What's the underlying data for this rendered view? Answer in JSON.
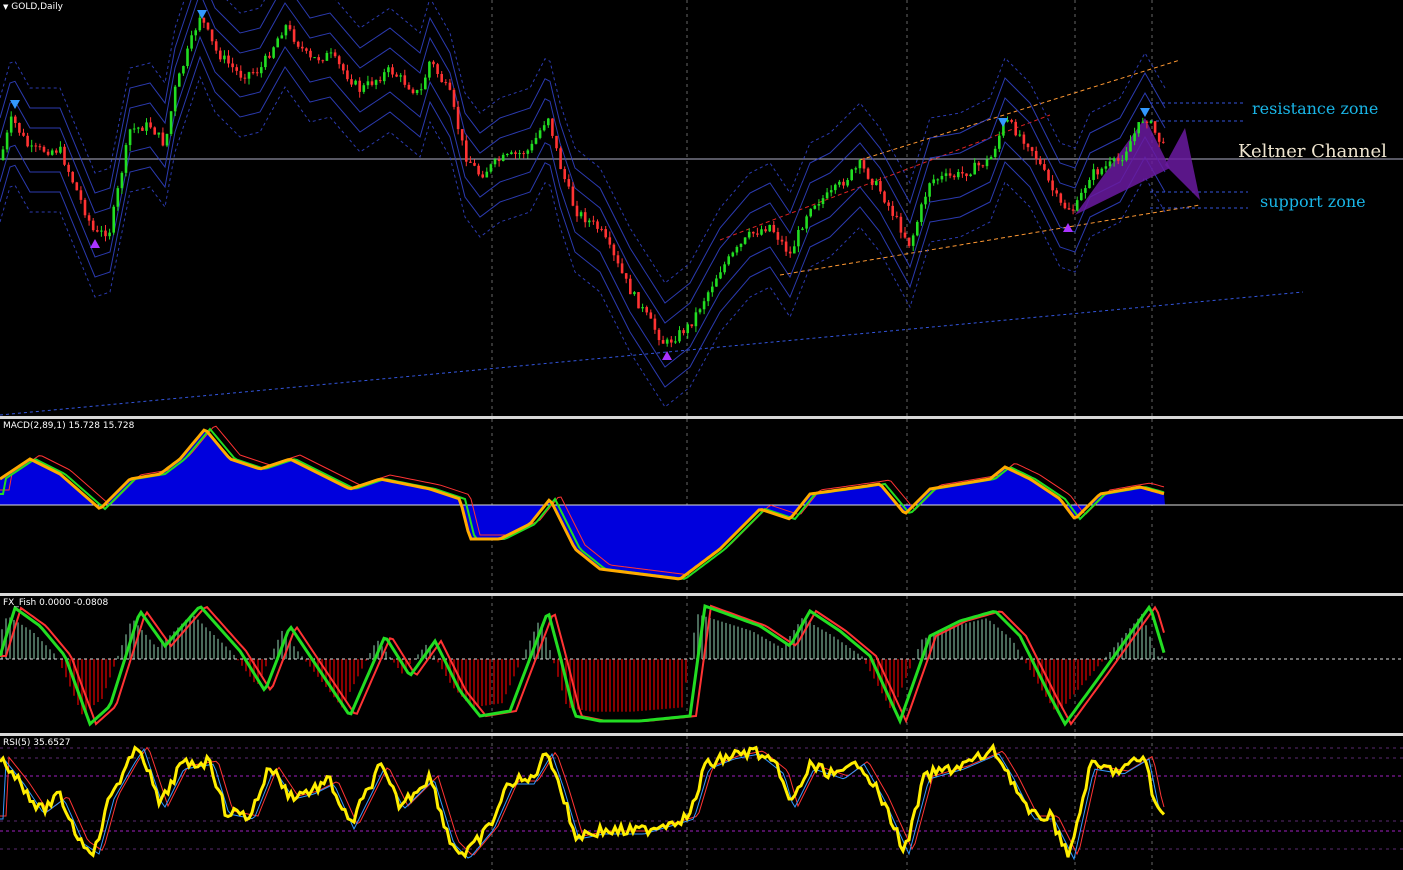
{
  "main_pane": {
    "label": "GOLD,Daily",
    "menu_icon": "triangle-down-icon",
    "annotations": {
      "resistance": "resistance zone",
      "keltner": "Keltner Channel",
      "support": "support zone"
    }
  },
  "macd_pane": {
    "label": "MACD(2,89,1) 15.728 15.728"
  },
  "fish_pane": {
    "label": "FX_Fish 0.0000 -0.0808"
  },
  "rsi_pane": {
    "label": "RSI(5) 35.6527"
  },
  "colors": {
    "bull": "#22dd22",
    "bear": "#ff3333",
    "channel": "#3344cc",
    "macd_fill": "#0000dd",
    "macd_orange": "#ffaa00",
    "macd_green": "#22dd22",
    "fish_pos": "#4a6a5a",
    "fish_neg": "#8a0000",
    "rsi_yellow": "#ffee00",
    "annotation": "#19b5e6",
    "pattern": "#6a1aa0"
  }
}
